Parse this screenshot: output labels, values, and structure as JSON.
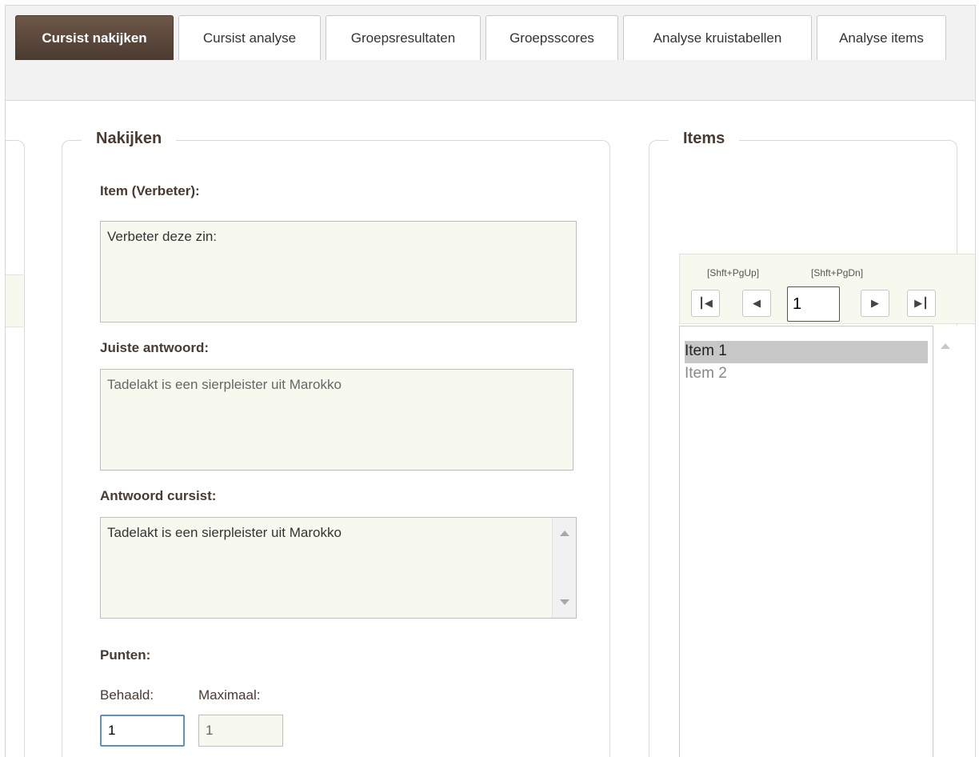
{
  "tabs": [
    {
      "label": "Cursist nakijken",
      "active": true
    },
    {
      "label": "Cursist analyse",
      "active": false
    },
    {
      "label": "Groepsresultaten",
      "active": false
    },
    {
      "label": "Groepsscores",
      "active": false
    },
    {
      "label": "Analyse kruistabellen",
      "active": false
    },
    {
      "label": "Analyse items",
      "active": false
    }
  ],
  "nakijken": {
    "legend": "Nakijken",
    "item_label": "Item (Verbeter):",
    "item_text": "Verbeter deze zin:",
    "correct_label": "Juiste antwoord:",
    "correct_text": "Tadelakt is een sierpleister uit Marokko",
    "student_label": "Antwoord cursist:",
    "student_text": "Tadelakt is een sierpleister uit Marokko",
    "points_label": "Punten:",
    "achieved_label": "Behaald:",
    "max_label": "Maximaal:",
    "achieved_value": "1",
    "max_value": "1"
  },
  "items": {
    "legend": "Items",
    "hint_prev": "[Shft+PgUp]",
    "hint_next": "[Shft+PgDn]",
    "page_value": "1",
    "first_icon": "first-page-icon",
    "prev_icon": "prev-page-icon",
    "next_icon": "next-page-icon",
    "last_icon": "last-page-icon",
    "list": [
      "Item 1",
      "Item 2"
    ],
    "selected_index": 0
  },
  "colors": {
    "accent": "#4a3a30",
    "field_bg": "#f8f9ee",
    "selected_bg": "#c7c7c7"
  }
}
